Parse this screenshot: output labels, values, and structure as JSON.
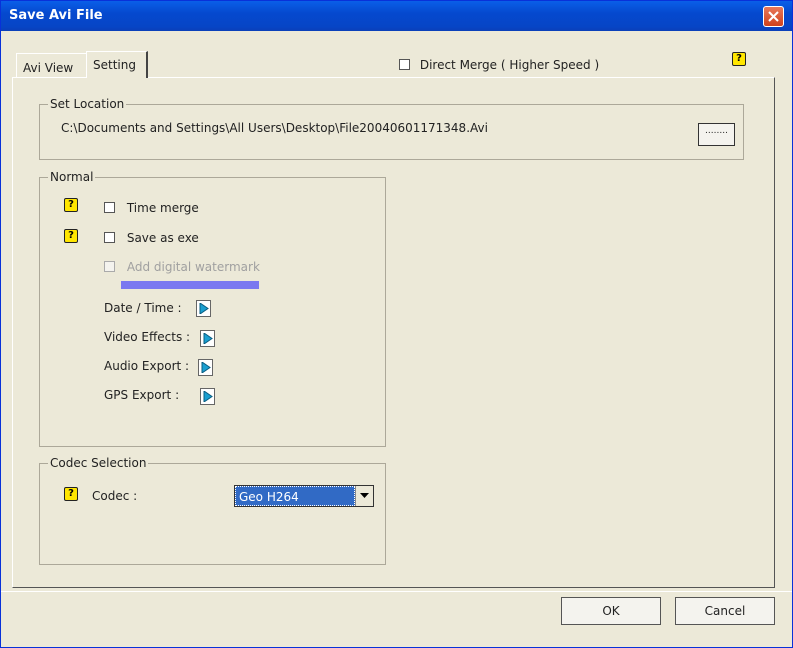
{
  "window": {
    "title": "Save Avi File"
  },
  "tabs": [
    {
      "label": "Avi View"
    },
    {
      "label": "Setting"
    }
  ],
  "direct_merge": {
    "label": "Direct Merge ( Higher Speed )",
    "checked": false
  },
  "set_location": {
    "legend": "Set Location",
    "path": "C:\\Documents and Settings\\All Users\\Desktop\\File20040601171348.Avi",
    "browse_label": "........"
  },
  "normal": {
    "legend": "Normal",
    "time_merge": {
      "label": "Time merge",
      "checked": false
    },
    "save_as_exe": {
      "label": "Save as exe",
      "checked": false
    },
    "add_watermark": {
      "label": "Add digital watermark",
      "checked": false,
      "enabled": false
    },
    "date_time": {
      "label": "Date / Time :"
    },
    "video_effects": {
      "label": "Video Effects :"
    },
    "audio_export": {
      "label": "Audio Export :"
    },
    "gps_export": {
      "label": "GPS Export :"
    }
  },
  "codec_selection": {
    "legend": "Codec Selection",
    "codec_label": "Codec :",
    "codec_value": "Geo H264"
  },
  "buttons": {
    "ok": "OK",
    "cancel": "Cancel"
  },
  "help_icon_glyph": "?",
  "colors": {
    "title_bar": "#0549cf",
    "selection": "#316ac5",
    "watermark_bar": "#7b79f0",
    "help_icon": "#ffe600"
  }
}
